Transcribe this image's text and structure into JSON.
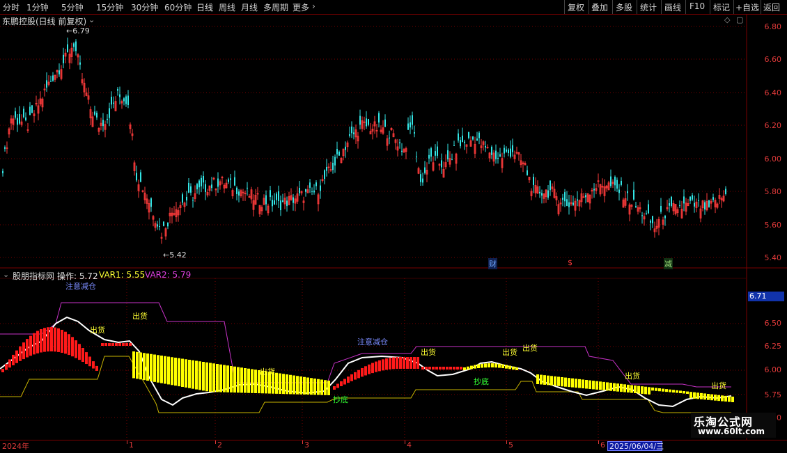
{
  "toolbar": {
    "periods": [
      "分时",
      "1分钟",
      "5分钟",
      "15分钟",
      "30分钟",
      "60分钟",
      "日线",
      "周线",
      "月线",
      "多周期",
      "更多"
    ],
    "active_period": "日线",
    "right_buttons": [
      "复权",
      "叠加",
      "多股",
      "统计",
      "画线",
      "F10",
      "标记",
      "+自选",
      "返回"
    ]
  },
  "main_chart": {
    "title": "东鹏控股(日线 前复权)",
    "high_label": "6.79",
    "low_label": "5.42",
    "y_axis": [
      "6.80",
      "6.60",
      "6.40",
      "6.20",
      "6.00",
      "5.80",
      "5.60",
      "5.40"
    ],
    "markers": [
      {
        "text": "财",
        "color": "#4a90ff"
      },
      {
        "text": "$",
        "color": "#ff3b3b"
      },
      {
        "text": "减",
        "color": "#9be07a"
      }
    ]
  },
  "indicator": {
    "name": "股朋指标网",
    "op_label": "操作: 5.72",
    "var1_label": "VAR1: 5.55",
    "var2_label": "VAR2: 5.79",
    "sub_title": "注意减仓",
    "y_axis": [
      "6.50",
      "6.25",
      "6.00",
      "5.75",
      "5.50"
    ],
    "current_tag": "6.71",
    "annotations": [
      {
        "text": "出货",
        "color": "#ffff33"
      },
      {
        "text": "出货",
        "color": "#ffff33"
      },
      {
        "text": "出货",
        "color": "#ffff33"
      },
      {
        "text": "出货",
        "color": "#ffff33"
      },
      {
        "text": "出货",
        "color": "#ffff33"
      },
      {
        "text": "出货",
        "color": "#ffff33"
      },
      {
        "text": "出货",
        "color": "#ffff33"
      },
      {
        "text": "出货",
        "color": "#ffff33"
      },
      {
        "text": "注意减仓",
        "color": "#7b8cff"
      },
      {
        "text": "抄底",
        "color": "#33ff33"
      },
      {
        "text": "抄底",
        "color": "#33ff33"
      }
    ]
  },
  "time_axis": {
    "labels": [
      "2024年",
      "1",
      "2",
      "3",
      "4",
      "5",
      "6"
    ],
    "current_date": "2025/06/04/三"
  },
  "watermark": {
    "title": "乐淘公式网",
    "url": "www.60lt.com"
  },
  "colors": {
    "up": "#ff3b3b",
    "down": "#33e6e6",
    "grid": "#7a0000",
    "ma_white": "#ffffff",
    "bar_yellow": "#ffff00",
    "bar_red": "#ff1a1a",
    "line_purple": "#c832c8",
    "line_yellow": "#c8b400"
  }
}
